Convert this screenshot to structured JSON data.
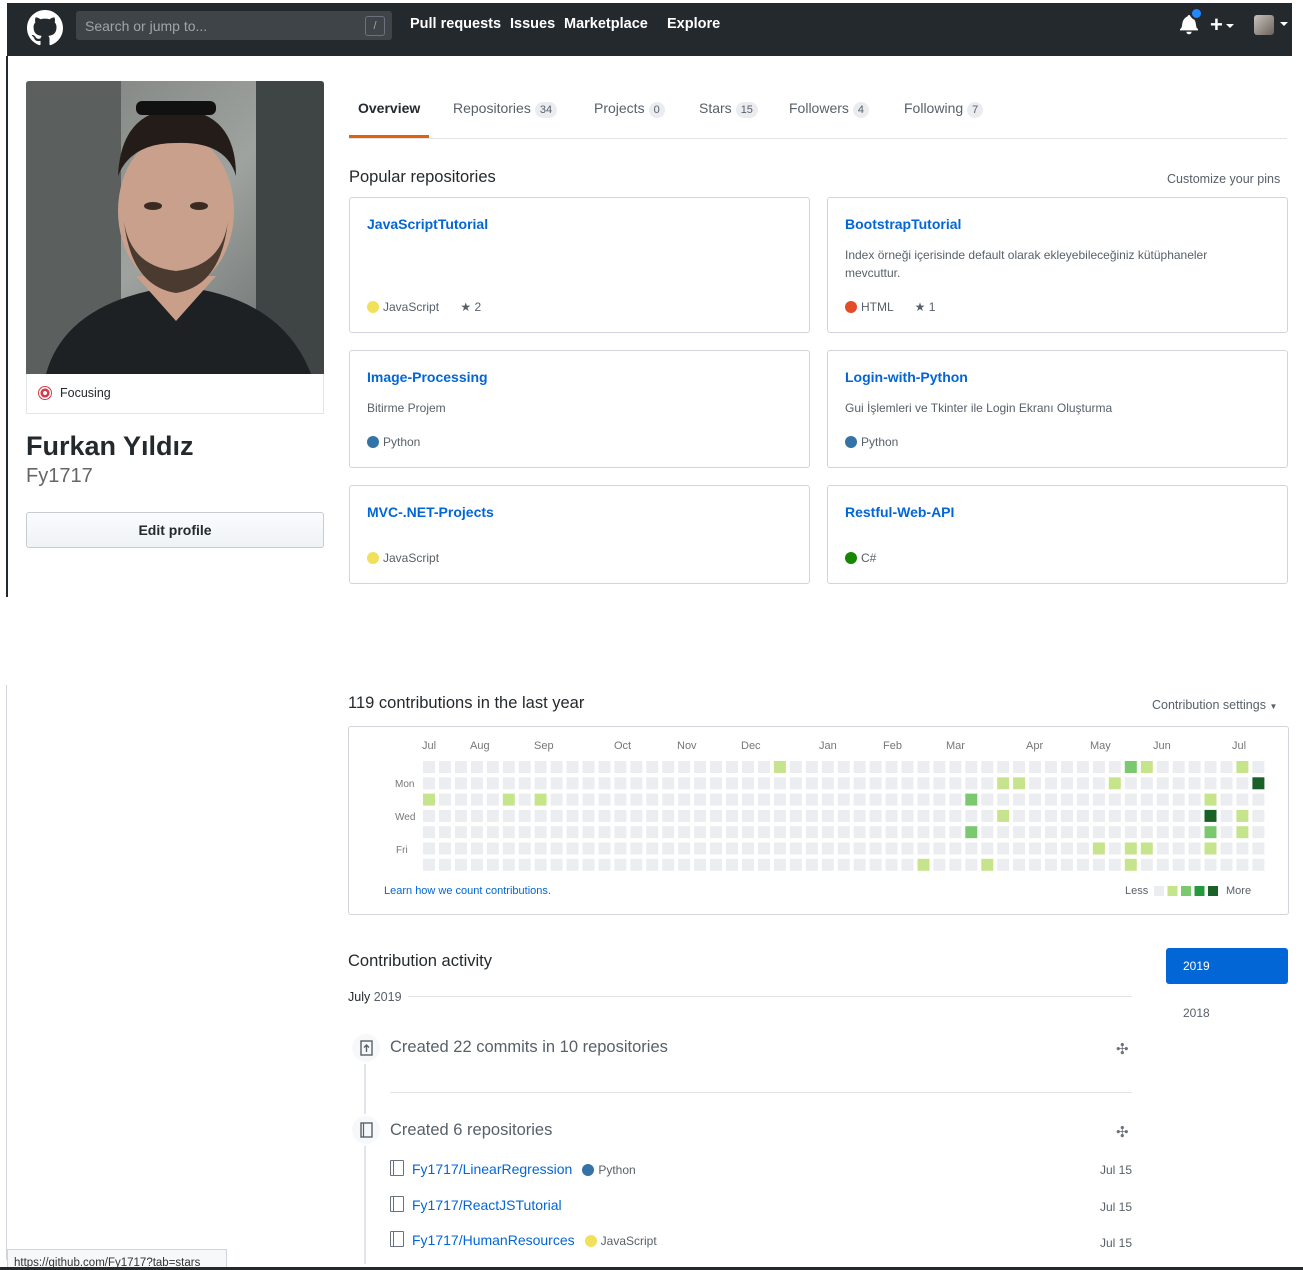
{
  "nav": {
    "search_placeholder": "Search or jump to...",
    "slash": "/",
    "links": [
      "Pull requests",
      "Issues",
      "Marketplace",
      "Explore"
    ],
    "plus": "+"
  },
  "profile": {
    "status": "Focusing",
    "full_name": "Furkan Yıldız",
    "username": "Fy1717",
    "edit_button": "Edit profile"
  },
  "tabs": [
    {
      "label": "Overview",
      "count": ""
    },
    {
      "label": "Repositories",
      "count": "34"
    },
    {
      "label": "Projects",
      "count": "0"
    },
    {
      "label": "Stars",
      "count": "15"
    },
    {
      "label": "Followers",
      "count": "4"
    },
    {
      "label": "Following",
      "count": "7"
    }
  ],
  "pinned": {
    "title": "Popular repositories",
    "customize": "Customize your pins",
    "repos": [
      {
        "name": "JavaScriptTutorial",
        "desc": "",
        "lang": "JavaScript",
        "lang_color": "#f1e05a",
        "stars": "2"
      },
      {
        "name": "BootstrapTutorial",
        "desc": "Index örneği içerisinde default olarak ekleyebileceğiniz kütüphaneler mevcuttur.",
        "lang": "HTML",
        "lang_color": "#e34c26",
        "stars": "1"
      },
      {
        "name": "Image-Processing",
        "desc": "Bitirme Projem",
        "lang": "Python",
        "lang_color": "#3572A5",
        "stars": ""
      },
      {
        "name": "Login-with-Python",
        "desc": "Gui İşlemleri ve Tkinter ile Login Ekranı Oluşturma",
        "lang": "Python",
        "lang_color": "#3572A5",
        "stars": ""
      },
      {
        "name": "MVC-.NET-Projects",
        "desc": "",
        "lang": "JavaScript",
        "lang_color": "#f1e05a",
        "stars": ""
      },
      {
        "name": "Restful-Web-API",
        "desc": "",
        "lang": "C#",
        "lang_color": "#178600",
        "stars": ""
      }
    ]
  },
  "contributions": {
    "title": "119 contributions in the last year",
    "settings": "Contribution settings",
    "months": [
      "Jul",
      "Aug",
      "Sep",
      "Oct",
      "Nov",
      "Dec",
      "Jan",
      "Feb",
      "Mar",
      "Apr",
      "May",
      "Jun",
      "Jul"
    ],
    "weekdays": [
      "Mon",
      "Wed",
      "Fri"
    ],
    "learn_link": "Learn how we count contributions.",
    "legend_less": "Less",
    "legend_more": "More",
    "colors": [
      "#ebedf0",
      "#c6e48b",
      "#7bc96f",
      "#239a3b",
      "#196127"
    ],
    "cells": [
      [
        0,
        2,
        1
      ],
      [
        5,
        2,
        1
      ],
      [
        7,
        2,
        1
      ],
      [
        22,
        0,
        1
      ],
      [
        34,
        2,
        2
      ],
      [
        34,
        4,
        2
      ],
      [
        31,
        6,
        1
      ],
      [
        35,
        6,
        1
      ],
      [
        36,
        1,
        1
      ],
      [
        36,
        3,
        1
      ],
      [
        37,
        1,
        1
      ],
      [
        43,
        1,
        1
      ],
      [
        42,
        5,
        1
      ],
      [
        44,
        0,
        2
      ],
      [
        45,
        0,
        1
      ],
      [
        44,
        5,
        1
      ],
      [
        45,
        5,
        1
      ],
      [
        44,
        6,
        1
      ],
      [
        49,
        2,
        1
      ],
      [
        49,
        3,
        4
      ],
      [
        49,
        4,
        2
      ],
      [
        49,
        5,
        1
      ],
      [
        51,
        0,
        1
      ],
      [
        51,
        3,
        1
      ],
      [
        51,
        4,
        1
      ],
      [
        52,
        1,
        4
      ]
    ]
  },
  "activity": {
    "title": "Contribution activity",
    "years": [
      "2019",
      "2018"
    ],
    "month": "July",
    "month_year": "2019",
    "commits_title": "Created 22 commits in 10 repositories",
    "repos_title": "Created 6 repositories",
    "repos": [
      {
        "name": "Fy1717/LinearRegression",
        "lang": "Python",
        "lang_color": "#3572A5",
        "date": "Jul 15"
      },
      {
        "name": "Fy1717/ReactJSTutorial",
        "lang": "",
        "lang_color": "",
        "date": "Jul 15"
      },
      {
        "name": "Fy1717/HumanResources",
        "lang": "JavaScript",
        "lang_color": "#f1e05a",
        "date": "Jul 15"
      }
    ]
  },
  "statusbar": "https://github.com/Fy1717?tab=stars"
}
